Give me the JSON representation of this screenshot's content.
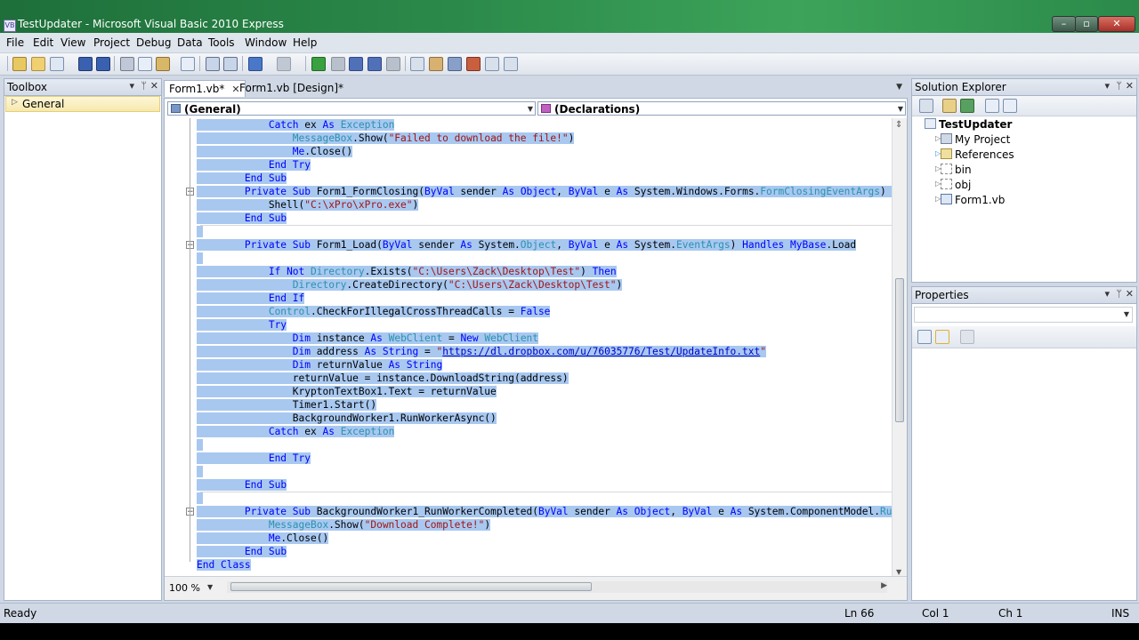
{
  "window": {
    "title": "TestUpdater - Microsoft Visual Basic 2010 Express",
    "app_icon": "vb-icon",
    "minimize": "–",
    "maximize": "▫",
    "close": "✕"
  },
  "menu": {
    "items": [
      "File",
      "Edit",
      "View",
      "Project",
      "Debug",
      "Data",
      "Tools",
      "Window",
      "Help"
    ]
  },
  "toolbox": {
    "title": "Toolbox",
    "group": "General"
  },
  "tabs": [
    {
      "label": "Form1.vb*",
      "active": true
    },
    {
      "label": "Form1.vb [Design]*",
      "active": false
    }
  ],
  "editor": {
    "class_combo": "(General)",
    "member_combo": "(Declarations)",
    "zoom": "100 %"
  },
  "code_lines": [
    [
      [
        "            ",
        ""
      ],
      [
        "Catch",
        "kw"
      ],
      [
        " ex ",
        ""
      ],
      [
        "As",
        "kw"
      ],
      [
        " ",
        ""
      ],
      [
        "Exception",
        "ty"
      ]
    ],
    [
      [
        "                ",
        ""
      ],
      [
        "MessageBox",
        "ty"
      ],
      [
        ".Show(",
        ""
      ],
      [
        "\"Failed to download the file!\"",
        "st"
      ],
      [
        ")",
        ""
      ]
    ],
    [
      [
        "                ",
        ""
      ],
      [
        "Me",
        "kw"
      ],
      [
        ".Close()",
        ""
      ]
    ],
    [
      [
        "            ",
        ""
      ],
      [
        "End",
        "kw"
      ],
      [
        " ",
        ""
      ],
      [
        "Try",
        "kw"
      ]
    ],
    [
      [
        "        ",
        ""
      ],
      [
        "End",
        "kw"
      ],
      [
        " ",
        ""
      ],
      [
        "Sub",
        "kw"
      ]
    ],
    [
      [
        "        ",
        ""
      ],
      [
        "Private",
        "kw"
      ],
      [
        " ",
        ""
      ],
      [
        "Sub",
        "kw"
      ],
      [
        " Form1_FormClosing(",
        ""
      ],
      [
        "ByVal",
        "kw"
      ],
      [
        " sender ",
        ""
      ],
      [
        "As",
        "kw"
      ],
      [
        " ",
        ""
      ],
      [
        "Object",
        "kw"
      ],
      [
        ", ",
        ""
      ],
      [
        "ByVal",
        "kw"
      ],
      [
        " e ",
        ""
      ],
      [
        "As",
        "kw"
      ],
      [
        " System.Windows.Forms.",
        ""
      ],
      [
        "FormClosingEventArgs",
        "ty"
      ],
      [
        ") ",
        ""
      ],
      [
        "Handles",
        "kw"
      ]
    ],
    [
      [
        "            Shell(",
        ""
      ],
      [
        "\"C:\\xPro\\xPro.exe\"",
        "st"
      ],
      [
        ")",
        ""
      ]
    ],
    [
      [
        "        ",
        ""
      ],
      [
        "End",
        "kw"
      ],
      [
        " ",
        ""
      ],
      [
        "Sub",
        "kw"
      ]
    ],
    [
      [
        "",
        ""
      ]
    ],
    [
      [
        "        ",
        ""
      ],
      [
        "Private",
        "kw"
      ],
      [
        " ",
        ""
      ],
      [
        "Sub",
        "kw"
      ],
      [
        " Form1_Load(",
        ""
      ],
      [
        "ByVal",
        "kw"
      ],
      [
        " sender ",
        ""
      ],
      [
        "As",
        "kw"
      ],
      [
        " System.",
        ""
      ],
      [
        "Object",
        "ty"
      ],
      [
        ", ",
        ""
      ],
      [
        "ByVal",
        "kw"
      ],
      [
        " e ",
        ""
      ],
      [
        "As",
        "kw"
      ],
      [
        " System.",
        ""
      ],
      [
        "EventArgs",
        "ty"
      ],
      [
        ") ",
        ""
      ],
      [
        "Handles",
        "kw"
      ],
      [
        " ",
        ""
      ],
      [
        "MyBase",
        "kw"
      ],
      [
        ".Load",
        ""
      ]
    ],
    [
      [
        "",
        ""
      ]
    ],
    [
      [
        "            ",
        ""
      ],
      [
        "If",
        "kw"
      ],
      [
        " ",
        ""
      ],
      [
        "Not",
        "kw"
      ],
      [
        " ",
        ""
      ],
      [
        "Directory",
        "ty"
      ],
      [
        ".Exists(",
        ""
      ],
      [
        "\"C:\\Users\\Zack\\Desktop\\Test\"",
        "st"
      ],
      [
        ") ",
        ""
      ],
      [
        "Then",
        "kw"
      ]
    ],
    [
      [
        "                ",
        ""
      ],
      [
        "Directory",
        "ty"
      ],
      [
        ".CreateDirectory(",
        ""
      ],
      [
        "\"C:\\Users\\Zack\\Desktop\\Test\"",
        "st"
      ],
      [
        ")",
        ""
      ]
    ],
    [
      [
        "            ",
        ""
      ],
      [
        "End",
        "kw"
      ],
      [
        " ",
        ""
      ],
      [
        "If",
        "kw"
      ]
    ],
    [
      [
        "            ",
        ""
      ],
      [
        "Control",
        "ty"
      ],
      [
        ".CheckForIllegalCrossThreadCalls = ",
        ""
      ],
      [
        "False",
        "kw"
      ]
    ],
    [
      [
        "            ",
        ""
      ],
      [
        "Try",
        "kw"
      ]
    ],
    [
      [
        "                ",
        ""
      ],
      [
        "Dim",
        "kw"
      ],
      [
        " instance ",
        ""
      ],
      [
        "As",
        "kw"
      ],
      [
        " ",
        ""
      ],
      [
        "WebClient",
        "ty"
      ],
      [
        " = ",
        ""
      ],
      [
        "New",
        "kw"
      ],
      [
        " ",
        ""
      ],
      [
        "WebClient",
        "ty"
      ]
    ],
    [
      [
        "                ",
        ""
      ],
      [
        "Dim",
        "kw"
      ],
      [
        " address ",
        ""
      ],
      [
        "As",
        "kw"
      ],
      [
        " ",
        ""
      ],
      [
        "String",
        "kw"
      ],
      [
        " = ",
        ""
      ],
      [
        "\"",
        "st"
      ],
      [
        "https://dl.dropbox.com/u/76035776/Test/UpdateInfo.txt",
        "ln"
      ],
      [
        "\"",
        "st"
      ]
    ],
    [
      [
        "                ",
        ""
      ],
      [
        "Dim",
        "kw"
      ],
      [
        " returnValue ",
        ""
      ],
      [
        "As",
        "kw"
      ],
      [
        " ",
        ""
      ],
      [
        "String",
        "kw"
      ]
    ],
    [
      [
        "                returnValue = instance.DownloadString(address)",
        ""
      ]
    ],
    [
      [
        "                KryptonTextBox1.Text = returnValue",
        ""
      ]
    ],
    [
      [
        "                Timer1.Start()",
        ""
      ]
    ],
    [
      [
        "                BackgroundWorker1.RunWorkerAsync()",
        ""
      ]
    ],
    [
      [
        "            ",
        ""
      ],
      [
        "Catch",
        "kw"
      ],
      [
        " ex ",
        ""
      ],
      [
        "As",
        "kw"
      ],
      [
        " ",
        ""
      ],
      [
        "Exception",
        "ty"
      ]
    ],
    [
      [
        "",
        ""
      ]
    ],
    [
      [
        "            ",
        ""
      ],
      [
        "End",
        "kw"
      ],
      [
        " ",
        ""
      ],
      [
        "Try",
        "kw"
      ]
    ],
    [
      [
        "",
        ""
      ]
    ],
    [
      [
        "        ",
        ""
      ],
      [
        "End",
        "kw"
      ],
      [
        " ",
        ""
      ],
      [
        "Sub",
        "kw"
      ]
    ],
    [
      [
        "",
        ""
      ]
    ],
    [
      [
        "        ",
        ""
      ],
      [
        "Private",
        "kw"
      ],
      [
        " ",
        ""
      ],
      [
        "Sub",
        "kw"
      ],
      [
        " BackgroundWorker1_RunWorkerCompleted(",
        ""
      ],
      [
        "ByVal",
        "kw"
      ],
      [
        " sender ",
        ""
      ],
      [
        "As",
        "kw"
      ],
      [
        " ",
        ""
      ],
      [
        "Object",
        "kw"
      ],
      [
        ", ",
        ""
      ],
      [
        "ByVal",
        "kw"
      ],
      [
        " e ",
        ""
      ],
      [
        "As",
        "kw"
      ],
      [
        " System.ComponentModel.",
        ""
      ],
      [
        "RunWorker",
        "ty"
      ]
    ],
    [
      [
        "            ",
        ""
      ],
      [
        "MessageBox",
        "ty"
      ],
      [
        ".Show(",
        ""
      ],
      [
        "\"Download Complete!\"",
        "st"
      ],
      [
        ")",
        ""
      ]
    ],
    [
      [
        "            ",
        ""
      ],
      [
        "Me",
        "kw"
      ],
      [
        ".Close()",
        ""
      ]
    ],
    [
      [
        "        ",
        ""
      ],
      [
        "End",
        "kw"
      ],
      [
        " ",
        ""
      ],
      [
        "Sub",
        "kw"
      ]
    ],
    [
      [
        "",
        ""
      ],
      [
        "End",
        "kw"
      ],
      [
        " ",
        ""
      ],
      [
        "Class",
        "kw"
      ]
    ]
  ],
  "solution_explorer": {
    "title": "Solution Explorer",
    "root": "TestUpdater",
    "items": [
      "My Project",
      "References",
      "bin",
      "obj",
      "Form1.vb"
    ]
  },
  "properties": {
    "title": "Properties"
  },
  "status": {
    "left": "Ready",
    "ln": "Ln 66",
    "col": "Col 1",
    "ch": "Ch 1",
    "mode": "INS"
  },
  "colors": {
    "keyword": "#0000ff",
    "type": "#2b91af",
    "string": "#a31515",
    "selection": "#a8c8f0",
    "titlebar": "#2b8a4a"
  }
}
